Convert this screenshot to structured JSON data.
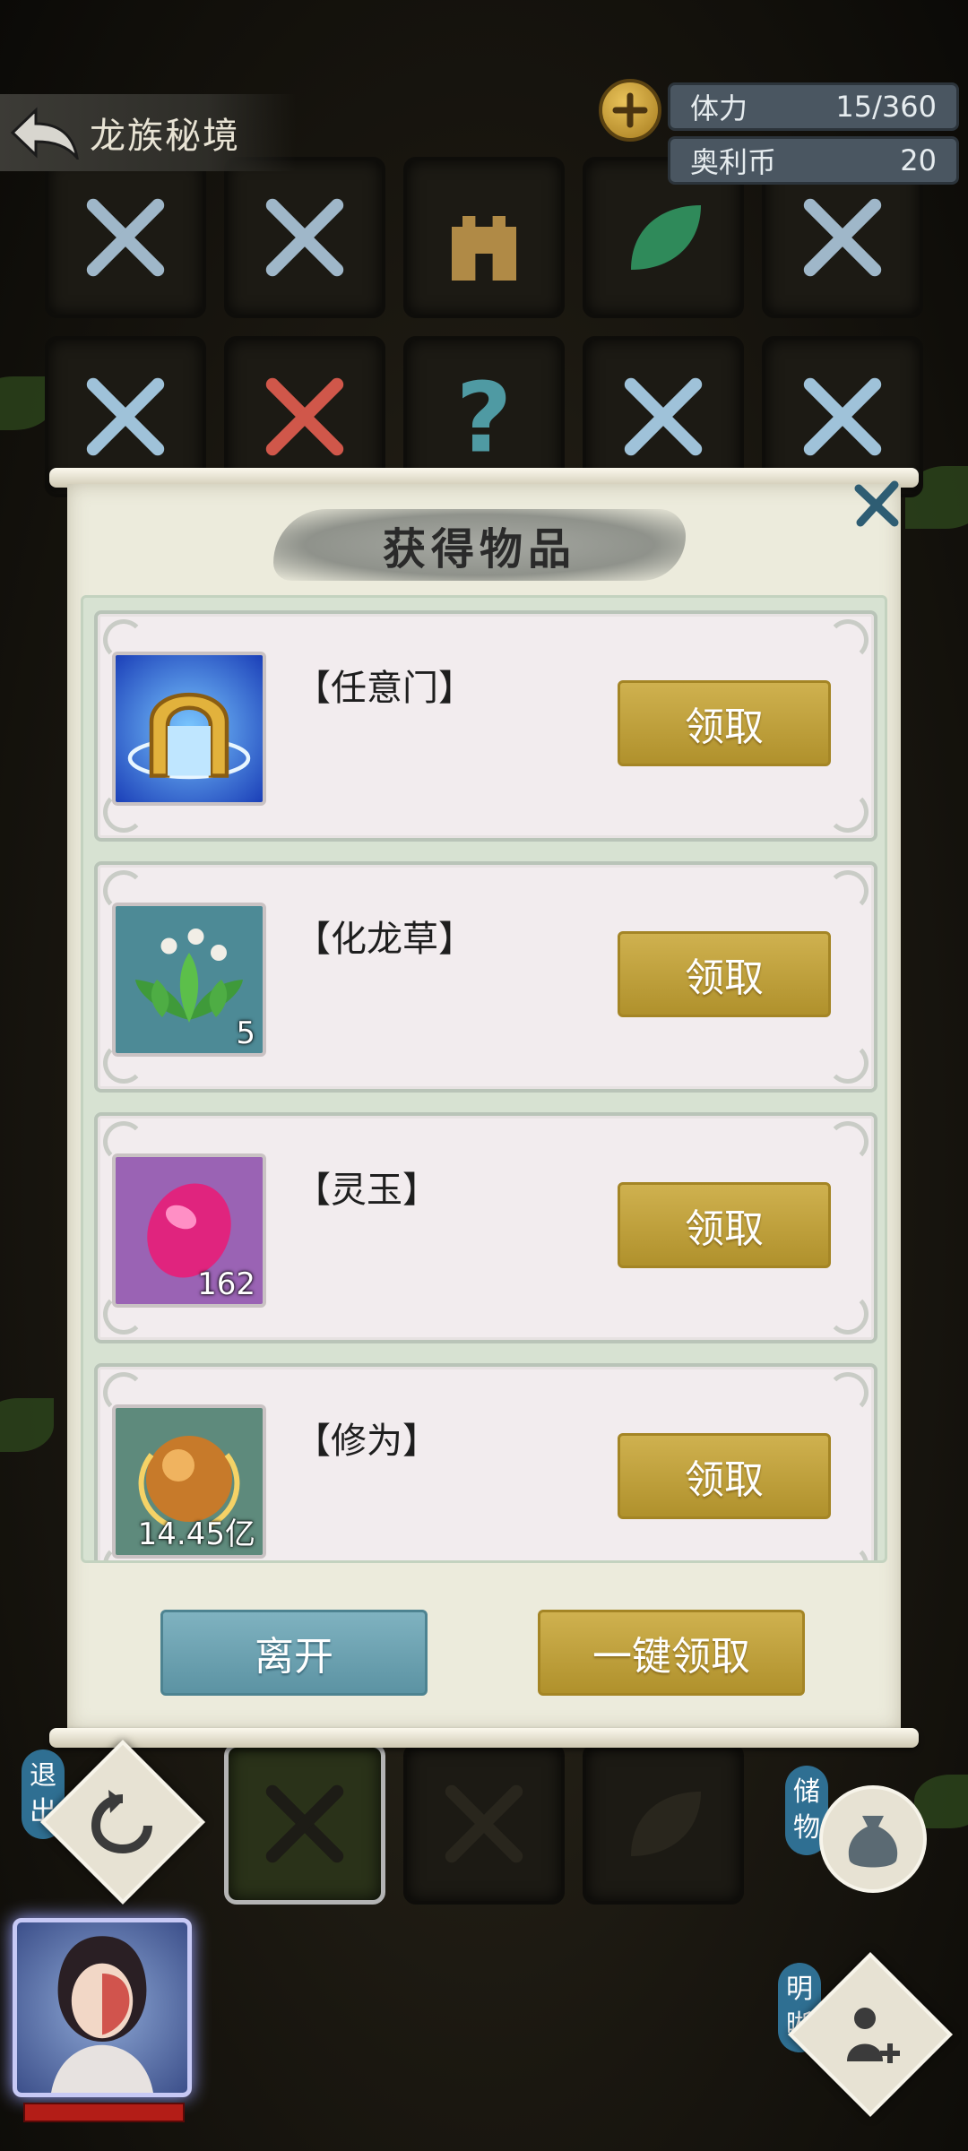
{
  "header": {
    "title": "龙族秘境",
    "resources": [
      {
        "label": "体力",
        "value": "15/360"
      },
      {
        "label": "奥利币",
        "value": "20"
      }
    ]
  },
  "modal": {
    "title": "获得物品",
    "items": [
      {
        "name": "【任意门】",
        "count": "",
        "icon": "golden-gate-icon",
        "claim_label": "领取"
      },
      {
        "name": "【化龙草】",
        "count": "5",
        "icon": "dragon-herb-icon",
        "claim_label": "领取"
      },
      {
        "name": "【灵玉】",
        "count": "162",
        "icon": "spirit-jade-icon",
        "claim_label": "领取"
      },
      {
        "name": "【修为】",
        "count": "14.45亿",
        "icon": "cultivation-orb-icon",
        "claim_label": "领取"
      }
    ],
    "leave_label": "离开",
    "claim_all_label": "一键领取"
  },
  "controls": {
    "exit_label": "退出",
    "storage_label": "储物",
    "insight_label": "明晰"
  },
  "colors": {
    "gold_button": "#c2a23d",
    "teal_button": "#6ea3b2",
    "paper": "#ecebdc",
    "resource_box": "#4a5661"
  }
}
